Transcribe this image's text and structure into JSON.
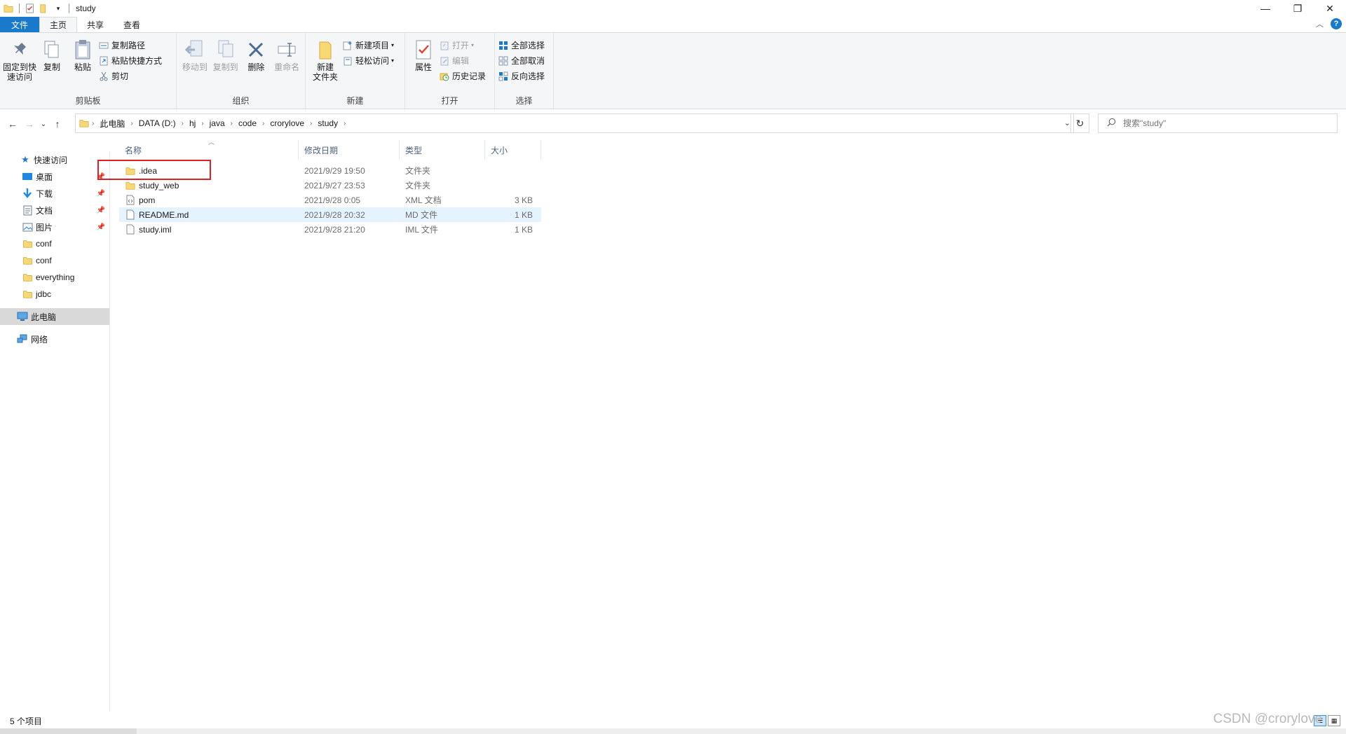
{
  "window": {
    "title": "study",
    "controls": {
      "minimize": "—",
      "restore": "❐",
      "close": "✕"
    }
  },
  "tabs": [
    {
      "label": "文件",
      "kind": "file"
    },
    {
      "label": "主页",
      "kind": "active"
    },
    {
      "label": "共享",
      "kind": "normal"
    },
    {
      "label": "查看",
      "kind": "normal"
    }
  ],
  "help": "?",
  "ribbon": {
    "clipboard": {
      "label": "剪贴板",
      "pin": "固定到快\n速访问",
      "copy": "复制",
      "paste": "粘贴",
      "copy_path": "复制路径",
      "paste_shortcut": "粘贴快捷方式",
      "cut": "剪切"
    },
    "organize": {
      "label": "组织",
      "move_to": "移动到",
      "copy_to": "复制到",
      "delete": "删除",
      "rename": "重命名"
    },
    "new": {
      "label": "新建",
      "new_folder": "新建\n文件夹",
      "new_item": "新建项目",
      "easy_access": "轻松访问"
    },
    "open": {
      "label": "打开",
      "properties": "属性",
      "open": "打开",
      "edit": "编辑",
      "history": "历史记录"
    },
    "select": {
      "label": "选择",
      "select_all": "全部选择",
      "select_none": "全部取消",
      "invert": "反向选择"
    }
  },
  "address": {
    "crumbs": [
      "此电脑",
      "DATA (D:)",
      "hj",
      "java",
      "code",
      "crorylove",
      "study"
    ]
  },
  "search": {
    "placeholder": "搜索\"study\""
  },
  "navpane": {
    "quick_access": "快速访问",
    "items": [
      {
        "label": "桌面",
        "icon": "desktop-icon",
        "pinned": true
      },
      {
        "label": "下载",
        "icon": "download-icon",
        "pinned": true
      },
      {
        "label": "文档",
        "icon": "document-icon",
        "pinned": true
      },
      {
        "label": "图片",
        "icon": "picture-icon",
        "pinned": true
      },
      {
        "label": "conf",
        "icon": "folder-icon",
        "pinned": false
      },
      {
        "label": "conf",
        "icon": "folder-icon",
        "pinned": false
      },
      {
        "label": "everything",
        "icon": "folder-icon",
        "pinned": false
      },
      {
        "label": "jdbc",
        "icon": "folder-icon",
        "pinned": false
      }
    ],
    "this_pc": "此电脑",
    "network": "网络"
  },
  "columns": {
    "name": "名称",
    "date": "修改日期",
    "type": "类型",
    "size": "大小"
  },
  "files": [
    {
      "name": ".idea",
      "date": "2021/9/29 19:50",
      "type": "文件夹",
      "size": "",
      "icon": "folder-icon"
    },
    {
      "name": "study_web",
      "date": "2021/9/27 23:53",
      "type": "文件夹",
      "size": "",
      "icon": "folder-icon"
    },
    {
      "name": "pom",
      "date": "2021/9/28 0:05",
      "type": "XML 文档",
      "size": "3 KB",
      "icon": "xml-file-icon"
    },
    {
      "name": "README.md",
      "date": "2021/9/28 20:32",
      "type": "MD 文件",
      "size": "1 KB",
      "icon": "file-icon"
    },
    {
      "name": "study.iml",
      "date": "2021/9/28 21:20",
      "type": "IML 文件",
      "size": "1 KB",
      "icon": "file-icon"
    }
  ],
  "status": {
    "item_count": "5 个项目"
  },
  "watermark": "CSDN @crorylove",
  "colors": {
    "accent": "#1979ca",
    "highlight": "#e02020",
    "hover": "#e5f3ff",
    "folder": "#f8d775"
  }
}
